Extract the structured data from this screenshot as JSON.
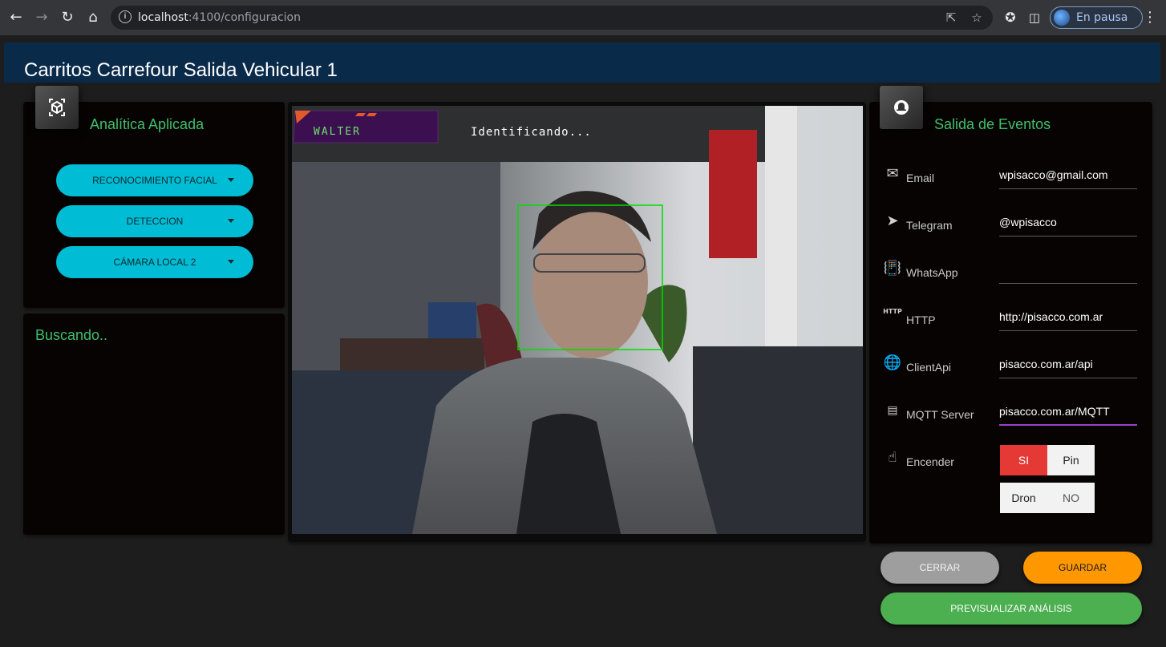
{
  "browser": {
    "url_host": "localhost",
    "url_rest": ":4100/configuracion",
    "profile_label": "En pausa"
  },
  "app": {
    "title": "Carritos Carrefour Salida Vehicular 1"
  },
  "analytics": {
    "title": "Analítica Aplicada",
    "selects": [
      "RECONOCIMIENTO FACIAL",
      "DETECCION",
      "CÁMARA LOCAL 2"
    ]
  },
  "status": {
    "text": "Buscando.."
  },
  "video": {
    "name_tag": "WALTER",
    "status": "Identificando..."
  },
  "events": {
    "title": "Salida de Eventos",
    "fields": [
      {
        "label": "Email",
        "value": "wpisacco@gmail.com",
        "icon": "email-icon"
      },
      {
        "label": "Telegram",
        "value": "@wpisacco",
        "icon": "send-icon"
      },
      {
        "label": "WhatsApp",
        "value": "",
        "icon": "vibration-icon"
      },
      {
        "label": "HTTP",
        "value": "http://pisacco.com.ar",
        "icon": "http-icon"
      },
      {
        "label": "ClientApi",
        "value": "pisacco.com.ar/api",
        "icon": "globe-icon"
      },
      {
        "label": "MQTT Server",
        "value": "pisacco.com.ar/MQTT",
        "icon": "router-icon"
      }
    ],
    "encender_label": "Encender",
    "toggle": {
      "si": "SI",
      "pin": "Pin",
      "dron": "Dron",
      "no": "NO"
    }
  },
  "actions": {
    "cerrar": "CERRAR",
    "guardar": "GUARDAR",
    "previsualizar": "PREVISUALIZAR ANÁLISIS"
  },
  "colors": {
    "accent_green": "#3fbf6a",
    "select_cyan": "#00bcd4",
    "guardar_orange": "#ff9800",
    "previsualizar_green": "#4caf50",
    "si_red": "#e53935"
  }
}
